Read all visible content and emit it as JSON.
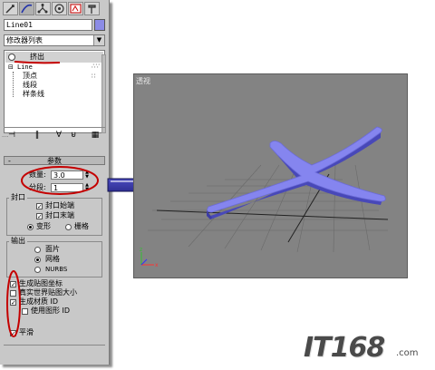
{
  "panel": {
    "tabs": [
      "create-tab",
      "modify-tab",
      "hierarchy-tab",
      "motion-tab",
      "display-tab",
      "utilities-tab"
    ],
    "object_name": "Line01",
    "object_color": "#8c8ce6",
    "modifier_list": "修改器列表",
    "stack": {
      "extrude": "挤出",
      "line": "Line",
      "sub_vertex": "顶点",
      "sub_segment": "线段",
      "sub_spline": "样条线"
    },
    "params": {
      "header": "参数",
      "amount_label": "数量:",
      "amount_value": "3.0",
      "segments_label": "分段:",
      "segments_value": "1",
      "capping_title": "封口",
      "cap_start": "封口始端",
      "cap_end": "封口末端",
      "morph": "变形",
      "grid": "栅格",
      "output_title": "输出",
      "patch": "面片",
      "mesh": "网格",
      "nurbs": "NURBS",
      "gen_map": "生成贴图坐标",
      "real_world": "真实世界贴图大小",
      "gen_mat": "生成材质 ID",
      "use_shape": "使用图形 ID",
      "smooth": "平滑"
    }
  },
  "viewport": {
    "label": "透视",
    "background": "#838383",
    "shape_color": "#8585ef"
  },
  "annotation_color": "#c40000",
  "arrow_color": "#2a2a8c",
  "logo": {
    "text": "IT168",
    "suffix": ".com",
    "color": "#4a4a4a"
  }
}
